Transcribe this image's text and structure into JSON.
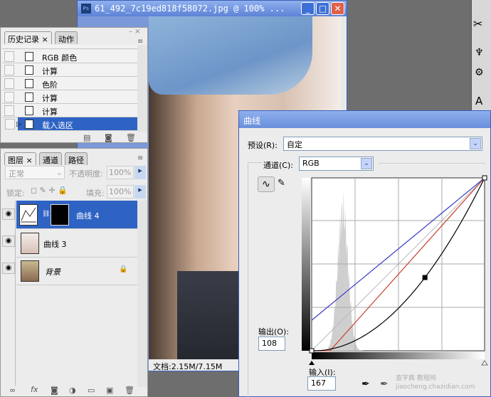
{
  "document": {
    "title": "61_492_7c19ed818f58072.jpg @ 100% ...",
    "status": "文档:2.15M/7.15M",
    "buttons": {
      "minimize": "_",
      "maximize": "□",
      "close": "✕"
    }
  },
  "history_panel": {
    "tabs": [
      {
        "label": "历史记录",
        "active": true
      },
      {
        "label": "动作",
        "active": false
      }
    ],
    "items": [
      {
        "label": "RGB 颜色",
        "selected": false
      },
      {
        "label": "计算",
        "selected": false
      },
      {
        "label": "色阶",
        "selected": false
      },
      {
        "label": "计算",
        "selected": false
      },
      {
        "label": "计算",
        "selected": false
      },
      {
        "label": "载入选区",
        "selected": true
      }
    ]
  },
  "layers_panel": {
    "tabs": [
      {
        "label": "图层",
        "active": true
      },
      {
        "label": "通道",
        "active": false
      },
      {
        "label": "路径",
        "active": false
      }
    ],
    "blend_mode": "正常",
    "opacity_label": "不透明度:",
    "opacity": "100%",
    "lock_label": "锁定:",
    "fill_label": "填充:",
    "fill": "100%",
    "layers": [
      {
        "name": "曲线 4",
        "selected": true,
        "type": "adjustment"
      },
      {
        "name": "曲线 3",
        "selected": false,
        "type": "adjustment"
      },
      {
        "name": "背景",
        "selected": false,
        "type": "background",
        "locked": true
      }
    ]
  },
  "curves_dialog": {
    "title": "曲线",
    "preset_label": "预设(R):",
    "preset_value": "自定",
    "channel_label": "通道(C):",
    "channel_value": "RGB",
    "output_label": "输出(O):",
    "output_value": "108",
    "input_label": "输入(I):",
    "input_value": "167",
    "curves": {
      "rgb": {
        "color": "#000000",
        "points": [
          [
            0,
            0
          ],
          [
            167,
            108
          ],
          [
            255,
            255
          ]
        ]
      },
      "red": {
        "color": "#c84030",
        "points": [
          [
            0,
            0
          ],
          [
            27,
            0
          ],
          [
            255,
            255
          ]
        ]
      },
      "blue": {
        "color": "#3a3ac8",
        "points": [
          [
            0,
            45
          ],
          [
            255,
            255
          ]
        ]
      }
    },
    "watermark": "查字典 教程网 jiaocheng.chazidian.com"
  },
  "right_toolbar": {
    "icons": [
      "tools-icon",
      "brush-presets-icon",
      "clone-source-icon",
      "character-icon"
    ]
  }
}
